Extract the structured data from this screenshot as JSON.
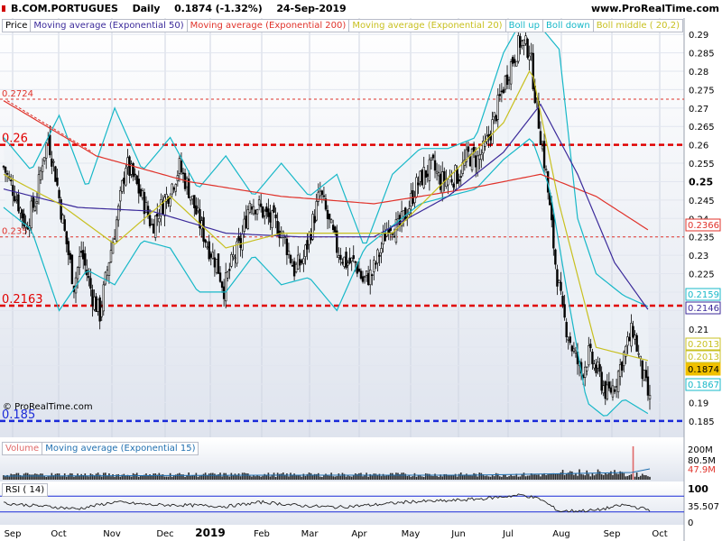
{
  "header": {
    "symbol": "B.COM.PORTUGUES",
    "period": "Daily",
    "last_change": "0.1874 (-1.32%)",
    "date": "24-Sep-2019",
    "source": "www.ProRealTime.com"
  },
  "legend": [
    {
      "label": "Price",
      "color": "#000000"
    },
    {
      "label": "Moving average (Exponential 50)",
      "color": "#3b2a9a"
    },
    {
      "label": "Moving average (Exponential 200)",
      "color": "#e0322a"
    },
    {
      "label": "Moving average (Exponential 20)",
      "color": "#c8c020"
    },
    {
      "label": "Boll up",
      "color": "#17b8c8"
    },
    {
      "label": "Boll down",
      "color": "#17b8c8"
    },
    {
      "label": "Boll middle ( 20,2)",
      "color": "#c8c020"
    }
  ],
  "copyright": "© ProRealTime.com",
  "volume_legend": [
    {
      "label": "Volume",
      "color": "#e06a6a"
    },
    {
      "label": "Moving average (Exponential 15)",
      "color": "#1f6fb0"
    }
  ],
  "rsi_legend": "RSI ( 14)",
  "chart_data": {
    "type": "candlestick",
    "price_axis": {
      "min": 0.183,
      "max": 0.292,
      "ticks": [
        "0.29",
        "0.285",
        "0.28",
        "0.275",
        "0.27",
        "0.265",
        "0.26",
        "0.255",
        "0.25",
        "0.245",
        "0.24",
        "0.235",
        "0.23",
        "0.225",
        "0.22",
        "0.215",
        "0.21",
        "0.205",
        "0.2",
        "0.195",
        "0.19",
        "0.185"
      ]
    },
    "x_labels": [
      "Sep",
      "Oct",
      "Nov",
      "Dec",
      "2019",
      "Feb",
      "Mar",
      "Apr",
      "May",
      "Jun",
      "Jul",
      "Aug",
      "Sep",
      "Oct"
    ],
    "horizontal_levels": [
      {
        "label": "0.2724",
        "value": 0.2724,
        "color": "#e0322a",
        "style": "thin-dashed"
      },
      {
        "label": "0.26",
        "value": 0.26,
        "color": "#e00000",
        "style": "thick-dashed"
      },
      {
        "label": "0.235",
        "value": 0.235,
        "color": "#e0322a",
        "style": "thin-dashed"
      },
      {
        "label": "0.2163",
        "value": 0.2163,
        "color": "#e00000",
        "style": "thick-dashed"
      },
      {
        "label": "0.185",
        "value": 0.185,
        "color": "#1a2ad8",
        "style": "thick-dashed"
      }
    ],
    "price_tags": [
      {
        "label": "0.2366",
        "color": "#e0322a"
      },
      {
        "label": "0.2159",
        "color": "#17b8c8"
      },
      {
        "label": "0.2146",
        "color": "#3b2a9a"
      },
      {
        "label": "0.2013",
        "color": "#c8c020"
      },
      {
        "label": "0.2013",
        "color": "#c8c020"
      },
      {
        "label": "0.1874",
        "color": "#f0c000"
      },
      {
        "label": "0.1867",
        "color": "#17b8c8"
      }
    ],
    "close_path": [
      [
        0,
        0.254
      ],
      [
        6,
        0.247
      ],
      [
        12,
        0.238
      ],
      [
        18,
        0.246
      ],
      [
        21,
        0.256
      ],
      [
        24,
        0.262
      ],
      [
        28,
        0.252
      ],
      [
        33,
        0.236
      ],
      [
        38,
        0.222
      ],
      [
        42,
        0.231
      ],
      [
        48,
        0.219
      ],
      [
        52,
        0.214
      ],
      [
        57,
        0.229
      ],
      [
        62,
        0.242
      ],
      [
        66,
        0.255
      ],
      [
        71,
        0.25
      ],
      [
        76,
        0.244
      ],
      [
        80,
        0.238
      ],
      [
        85,
        0.243
      ],
      [
        90,
        0.248
      ],
      [
        95,
        0.254
      ],
      [
        100,
        0.248
      ],
      [
        105,
        0.24
      ],
      [
        110,
        0.233
      ],
      [
        115,
        0.228
      ],
      [
        119,
        0.221
      ],
      [
        124,
        0.229
      ],
      [
        128,
        0.233
      ],
      [
        133,
        0.245
      ],
      [
        138,
        0.243
      ],
      [
        143,
        0.24
      ],
      [
        148,
        0.238
      ],
      [
        152,
        0.234
      ],
      [
        157,
        0.226
      ],
      [
        162,
        0.229
      ],
      [
        166,
        0.237
      ],
      [
        171,
        0.247
      ],
      [
        175,
        0.24
      ],
      [
        180,
        0.232
      ],
      [
        185,
        0.228
      ],
      [
        190,
        0.228
      ],
      [
        194,
        0.223
      ],
      [
        199,
        0.225
      ],
      [
        204,
        0.232
      ],
      [
        208,
        0.239
      ],
      [
        213,
        0.237
      ],
      [
        218,
        0.242
      ],
      [
        222,
        0.248
      ],
      [
        227,
        0.252
      ],
      [
        232,
        0.254
      ],
      [
        236,
        0.25
      ],
      [
        241,
        0.251
      ],
      [
        246,
        0.252
      ],
      [
        251,
        0.257
      ],
      [
        256,
        0.256
      ],
      [
        260,
        0.259
      ],
      [
        265,
        0.267
      ],
      [
        270,
        0.276
      ],
      [
        274,
        0.282
      ],
      [
        279,
        0.288
      ],
      [
        284,
        0.286
      ],
      [
        288,
        0.27
      ],
      [
        293,
        0.252
      ],
      [
        298,
        0.228
      ],
      [
        302,
        0.214
      ],
      [
        307,
        0.205
      ],
      [
        312,
        0.198
      ],
      [
        316,
        0.203
      ],
      [
        321,
        0.198
      ],
      [
        326,
        0.192
      ],
      [
        330,
        0.195
      ],
      [
        335,
        0.203
      ],
      [
        340,
        0.21
      ],
      [
        344,
        0.2
      ],
      [
        349,
        0.19
      ]
    ],
    "ema20": [
      [
        0,
        0.252
      ],
      [
        30,
        0.244
      ],
      [
        60,
        0.233
      ],
      [
        90,
        0.246
      ],
      [
        120,
        0.232
      ],
      [
        150,
        0.236
      ],
      [
        180,
        0.236
      ],
      [
        210,
        0.236
      ],
      [
        240,
        0.251
      ],
      [
        270,
        0.266
      ],
      [
        285,
        0.281
      ],
      [
        300,
        0.244
      ],
      [
        320,
        0.205
      ],
      [
        349,
        0.2013
      ]
    ],
    "ema50": [
      [
        0,
        0.248
      ],
      [
        40,
        0.243
      ],
      [
        80,
        0.242
      ],
      [
        120,
        0.236
      ],
      [
        160,
        0.235
      ],
      [
        200,
        0.235
      ],
      [
        240,
        0.246
      ],
      [
        270,
        0.258
      ],
      [
        290,
        0.271
      ],
      [
        310,
        0.252
      ],
      [
        330,
        0.228
      ],
      [
        349,
        0.2146
      ]
    ],
    "ema200": [
      [
        0,
        0.272
      ],
      [
        50,
        0.257
      ],
      [
        100,
        0.25
      ],
      [
        150,
        0.246
      ],
      [
        200,
        0.244
      ],
      [
        250,
        0.248
      ],
      [
        290,
        0.252
      ],
      [
        320,
        0.246
      ],
      [
        349,
        0.2366
      ]
    ],
    "boll_up": [
      [
        0,
        0.262
      ],
      [
        15,
        0.253
      ],
      [
        30,
        0.268
      ],
      [
        45,
        0.248
      ],
      [
        60,
        0.27
      ],
      [
        75,
        0.253
      ],
      [
        90,
        0.262
      ],
      [
        105,
        0.248
      ],
      [
        120,
        0.257
      ],
      [
        135,
        0.246
      ],
      [
        150,
        0.255
      ],
      [
        165,
        0.246
      ],
      [
        180,
        0.252
      ],
      [
        195,
        0.232
      ],
      [
        210,
        0.252
      ],
      [
        225,
        0.259
      ],
      [
        240,
        0.259
      ],
      [
        255,
        0.262
      ],
      [
        270,
        0.285
      ],
      [
        280,
        0.294
      ],
      [
        290,
        0.292
      ],
      [
        300,
        0.286
      ],
      [
        310,
        0.24
      ],
      [
        320,
        0.225
      ],
      [
        335,
        0.219
      ],
      [
        349,
        0.2159
      ]
    ],
    "boll_down": [
      [
        0,
        0.243
      ],
      [
        15,
        0.237
      ],
      [
        30,
        0.215
      ],
      [
        45,
        0.226
      ],
      [
        60,
        0.222
      ],
      [
        75,
        0.234
      ],
      [
        90,
        0.232
      ],
      [
        105,
        0.22
      ],
      [
        120,
        0.22
      ],
      [
        135,
        0.23
      ],
      [
        150,
        0.222
      ],
      [
        165,
        0.224
      ],
      [
        180,
        0.215
      ],
      [
        195,
        0.232
      ],
      [
        210,
        0.238
      ],
      [
        225,
        0.244
      ],
      [
        240,
        0.246
      ],
      [
        255,
        0.248
      ],
      [
        270,
        0.256
      ],
      [
        285,
        0.262
      ],
      [
        295,
        0.248
      ],
      [
        305,
        0.218
      ],
      [
        315,
        0.19
      ],
      [
        325,
        0.186
      ],
      [
        335,
        0.191
      ],
      [
        349,
        0.1867
      ]
    ],
    "volume_axis": {
      "ticks": [
        "200M",
        "80.5M",
        "47.9M"
      ]
    },
    "rsi_axis": {
      "ticks": [
        "100",
        "35.507",
        "0"
      ]
    },
    "rsi_path": [
      [
        0,
        52
      ],
      [
        20,
        45
      ],
      [
        40,
        38
      ],
      [
        60,
        55
      ],
      [
        80,
        48
      ],
      [
        100,
        47
      ],
      [
        120,
        44
      ],
      [
        140,
        55
      ],
      [
        160,
        46
      ],
      [
        180,
        42
      ],
      [
        200,
        48
      ],
      [
        220,
        56
      ],
      [
        240,
        58
      ],
      [
        260,
        64
      ],
      [
        280,
        73
      ],
      [
        290,
        62
      ],
      [
        300,
        32
      ],
      [
        320,
        34
      ],
      [
        335,
        48
      ],
      [
        349,
        35.5
      ]
    ]
  }
}
